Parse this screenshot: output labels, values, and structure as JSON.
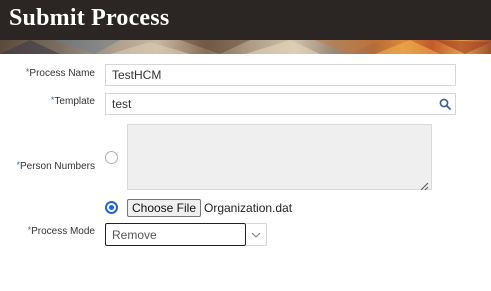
{
  "header": {
    "title": "Submit Process"
  },
  "form": {
    "required_mark": "*",
    "process_name": {
      "label": "Process Name",
      "value": "TestHCM"
    },
    "template": {
      "label": "Template",
      "value": "test",
      "search_icon": "search-icon"
    },
    "person_numbers": {
      "label": "Person Numbers",
      "selected": false
    },
    "file_upload": {
      "selected": true,
      "button_label": "Choose File",
      "file_name": "Organization.dat"
    },
    "process_mode": {
      "label": "Process Mode",
      "value": "Remove",
      "dropdown_icon": "chevron-down-icon"
    }
  },
  "colors": {
    "header_bg": "#2b2523",
    "accent": "#1a66d2",
    "required": "#2a6fb5"
  }
}
